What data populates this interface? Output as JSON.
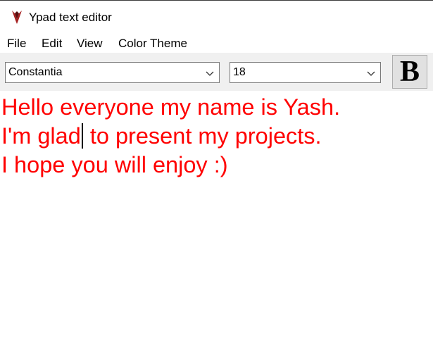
{
  "window": {
    "title": "Ypad text editor",
    "icon": "ypad-app-icon"
  },
  "menu": {
    "items": [
      {
        "label": "File"
      },
      {
        "label": "Edit"
      },
      {
        "label": "View"
      },
      {
        "label": "Color Theme"
      }
    ]
  },
  "toolbar": {
    "font_family": "Constantia",
    "font_size": "18",
    "bold_label": "B",
    "dropdown_icon": "chevron-down-icon"
  },
  "editor": {
    "text_color": "#ff0000",
    "lines": [
      "Hello everyone my name is Yash.",
      "I'm glad",
      " to present my projects.",
      "I hope you will enjoy :)"
    ]
  }
}
